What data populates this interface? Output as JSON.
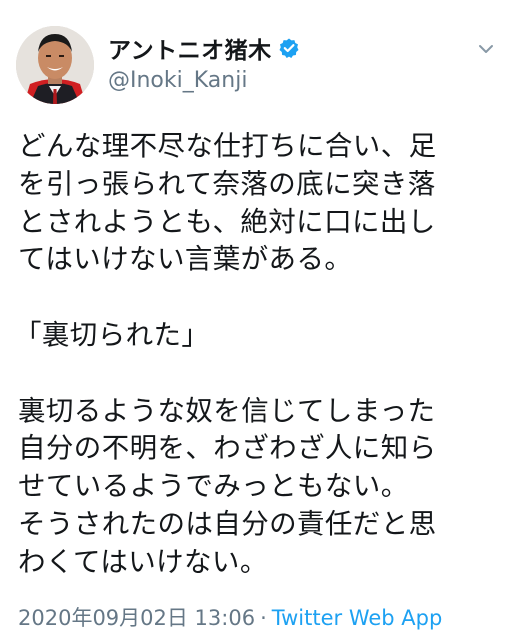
{
  "author": {
    "display_name": "アントニオ猪木",
    "handle": "@Inoki_Kanji",
    "verified": true
  },
  "tweet": {
    "lines": [
      "どんな理不尽な仕打ちに合い、足",
      "を引っ張られて奈落の底に突き落",
      "とされようとも、絶対に口に出し",
      "てはいけない言葉がある。",
      "",
      "「裏切られた」",
      "",
      "裏切るような奴を信じてしまった",
      "自分の不明を、わざわざ人に知ら",
      "せているようでみっともない。",
      "そうされたのは自分の責任だと思",
      "わくてはいけない。"
    ]
  },
  "meta": {
    "timestamp": "2020年09月02日 13:06",
    "separator": "·",
    "source": "Twitter Web App"
  },
  "colors": {
    "text": "#14171a",
    "secondary": "#657786",
    "accent": "#1da1f2"
  }
}
